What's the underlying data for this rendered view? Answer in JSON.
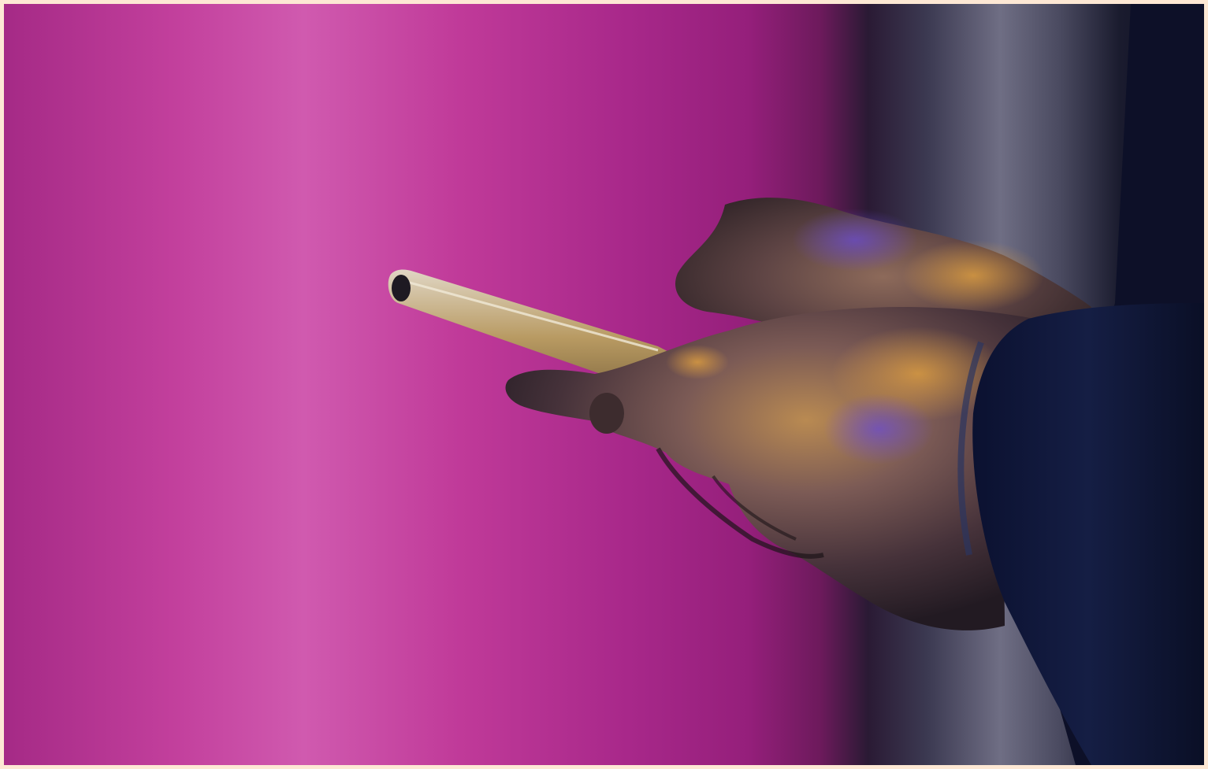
{
  "image": {
    "subject": "hands-holding-smartphone",
    "colors": {
      "border": "#fde8d4",
      "background_magenta": "#c0389a",
      "background_highlight": "#d25cb0",
      "background_deep": "#8a1f72",
      "backdrop_gray": "#6e6c80",
      "sleeve_navy": "#111a3a",
      "skin_shadow": "#3a2a2c",
      "phone_gold": "#b9985c"
    }
  }
}
